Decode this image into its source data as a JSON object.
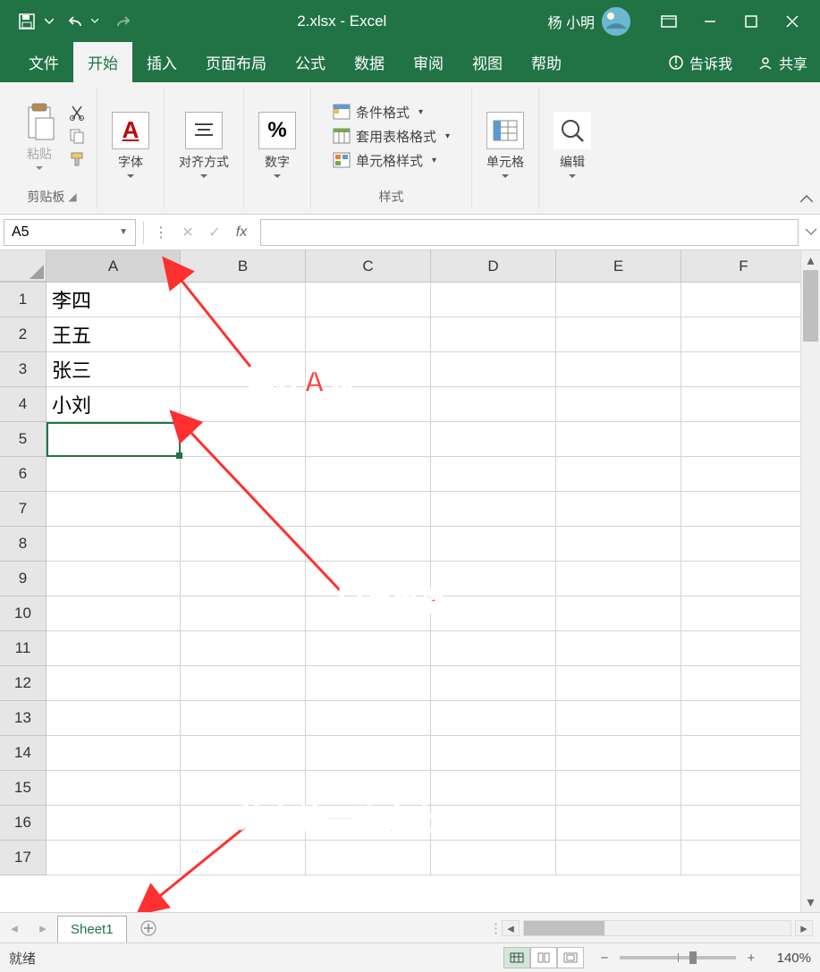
{
  "titlebar": {
    "filename": "2.xlsx",
    "appname": "Excel",
    "title_sep": " - ",
    "user_name": "杨 小明"
  },
  "menu": {
    "file": "文件",
    "home": "开始",
    "insert": "插入",
    "layout": "页面布局",
    "formulas": "公式",
    "data": "数据",
    "review": "审阅",
    "view": "视图",
    "help": "帮助",
    "tellme": "告诉我",
    "share": "共享"
  },
  "ribbon": {
    "clipboard": {
      "paste": "粘贴",
      "label": "剪贴板"
    },
    "font": {
      "label": "字体"
    },
    "alignment": {
      "label": "对齐方式"
    },
    "number": {
      "symbol": "%",
      "label": "数字"
    },
    "styles": {
      "conditional": "条件格式",
      "table": "套用表格格式",
      "cell": "单元格样式",
      "label": "样式"
    },
    "cells": {
      "label": "单元格"
    },
    "editing": {
      "label": "编辑"
    }
  },
  "formula_bar": {
    "name_box": "A5",
    "fx": "fx"
  },
  "columns": [
    "A",
    "B",
    "C",
    "D",
    "E",
    "F"
  ],
  "rows": [
    "1",
    "2",
    "3",
    "4",
    "5",
    "6",
    "7",
    "8",
    "9",
    "10",
    "11",
    "12",
    "13",
    "14",
    "15",
    "16",
    "17"
  ],
  "cells": {
    "A1": "李四",
    "A2": "王五",
    "A3": "张三",
    "A4": "小刘"
  },
  "annotations": {
    "ann1": "均在A列",
    "ann2": "只有姓名",
    "ann3": "均在第一张表上"
  },
  "sheet": {
    "name": "Sheet1"
  },
  "statusbar": {
    "ready": "就绪",
    "zoom": "140%"
  }
}
